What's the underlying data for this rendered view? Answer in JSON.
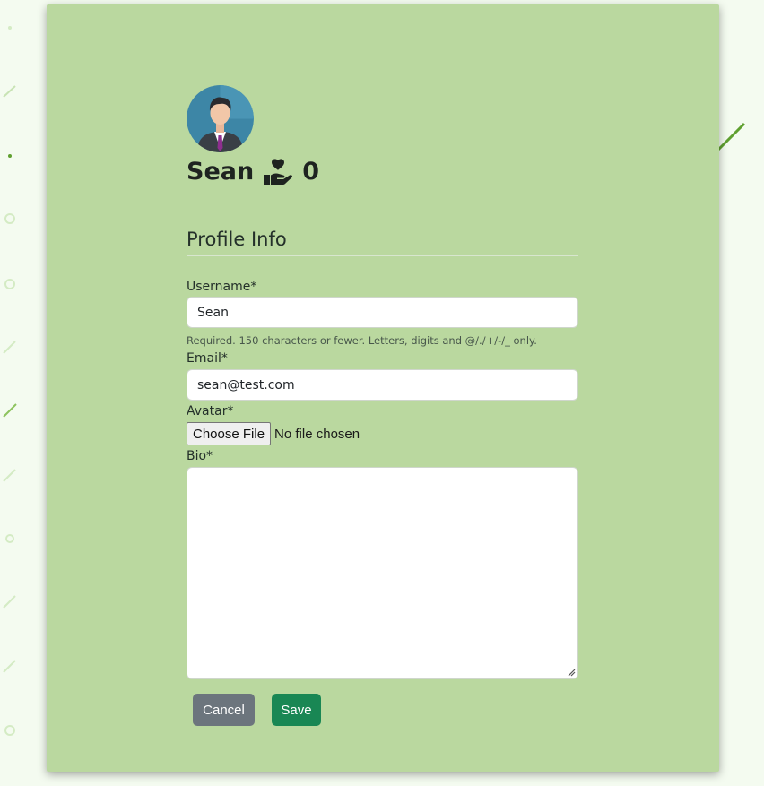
{
  "profile": {
    "name": "Sean",
    "hand_heart_icon": "hand-holding-heart-icon",
    "count": "0",
    "avatar_icon": "user-avatar-icon"
  },
  "form": {
    "section_title": "Profile Info",
    "username_label": "Username*",
    "username_value": "Sean",
    "username_help": "Required. 150 characters or fewer. Letters, digits and @/./+/-/_ only.",
    "email_label": "Email*",
    "email_value": "sean@test.com",
    "avatar_label": "Avatar*",
    "file_button_label": "Choose File",
    "file_status": "No file chosen",
    "bio_label": "Bio*",
    "bio_value": ""
  },
  "actions": {
    "cancel_label": "Cancel",
    "save_label": "Save"
  },
  "colors": {
    "card_background": "#bad89f",
    "page_background": "#f4fbf0",
    "cancel_button": "#6c757d",
    "save_button": "#198754"
  }
}
